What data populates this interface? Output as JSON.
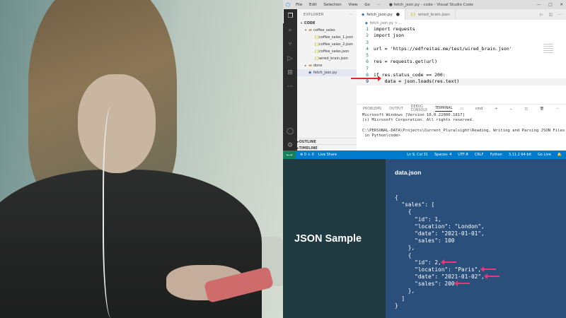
{
  "vscode": {
    "window_title": "● fetch_json.py - code - Visual Studio Code",
    "menu": [
      "File",
      "Edit",
      "Selection",
      "View",
      "Go",
      "···"
    ],
    "sidebar": {
      "header": "EXPLORER",
      "section": "CODE",
      "tree": [
        {
          "label": "coffee_sales",
          "kind": "folder",
          "open": true,
          "level": 1
        },
        {
          "label": "coffee_sales_1.json",
          "kind": "json",
          "level": 2
        },
        {
          "label": "coffee_sales_2.json",
          "kind": "json",
          "level": 2
        },
        {
          "label": "coffee_sales.json",
          "kind": "json",
          "level": 2
        },
        {
          "label": "wired_brain.json",
          "kind": "json",
          "level": 2
        },
        {
          "label": "done",
          "kind": "folder",
          "open": false,
          "level": 1
        },
        {
          "label": "fetch_json.py",
          "kind": "py",
          "level": 1,
          "selected": true
        }
      ],
      "outline": "OUTLINE",
      "timeline": "TIMELINE"
    },
    "tabs": [
      {
        "label": "fetch_json.py",
        "modified_marker": "●",
        "active": true
      },
      {
        "label": "wired_brain.json",
        "active": false
      }
    ],
    "breadcrumb": "fetch_json.py > ...",
    "code_lines": [
      {
        "n": "1",
        "text": "import requests"
      },
      {
        "n": "2",
        "text": "import json"
      },
      {
        "n": "3",
        "text": ""
      },
      {
        "n": "4",
        "text": "url = 'https://edfreitas.me/test/wired_brain.json'"
      },
      {
        "n": "5",
        "text": ""
      },
      {
        "n": "6",
        "text": "res = requests.get(url)"
      },
      {
        "n": "7",
        "text": ""
      },
      {
        "n": "8",
        "text": "if res.status_code == 200:"
      },
      {
        "n": "9",
        "text": "    data = json.loads(res.text)"
      }
    ],
    "panel_tabs": [
      "PROBLEMS",
      "OUTPUT",
      "DEBUG CONSOLE",
      "TERMINAL"
    ],
    "terminal_shell": "cmd",
    "terminal_lines": [
      "Microsoft Windows [Version 10.0.22000.1817]",
      "(c) Microsoft Corporation. All rights reserved.",
      "",
      "C:\\PERSONAL-DATA\\Projects\\Current_Pluralsight\\Reading, Writing and Parsing JSON Files",
      " in Python\\code>"
    ],
    "status": {
      "errors": "⊗ 0 ⚠ 0",
      "live_share": "Live Share",
      "position": "Ln 9, Col 31",
      "spaces": "Spaces: 4",
      "encoding": "UTF-8",
      "eol": "CRLF",
      "language": "Python",
      "interpreter": "3.11.2 64-bit",
      "golive": "Go Live"
    }
  },
  "slide": {
    "title": "JSON Sample",
    "file_title": "data.json",
    "json_lines": [
      {
        "text": "{",
        "arrow": false
      },
      {
        "text": "  \"sales\": [",
        "arrow": false
      },
      {
        "text": "    {",
        "arrow": false
      },
      {
        "text": "      \"id\": 1,",
        "arrow": false
      },
      {
        "text": "      \"location\": \"London\",",
        "arrow": false
      },
      {
        "text": "      \"date\": \"2021-01-01\",",
        "arrow": false
      },
      {
        "text": "      \"sales\": 100",
        "arrow": false
      },
      {
        "text": "    },",
        "arrow": false
      },
      {
        "text": "    {",
        "arrow": false
      },
      {
        "text": "      \"id\": 2,",
        "arrow": true
      },
      {
        "text": "      \"location\": \"Paris\",",
        "arrow": true
      },
      {
        "text": "      \"date\": \"2021-01-02\",",
        "arrow": true
      },
      {
        "text": "      \"sales\": 200",
        "arrow": true
      },
      {
        "text": "    },",
        "arrow": false
      },
      {
        "text": "  ]",
        "arrow": false
      },
      {
        "text": "}",
        "arrow": false
      }
    ],
    "arrow_color": "#e8377a"
  }
}
